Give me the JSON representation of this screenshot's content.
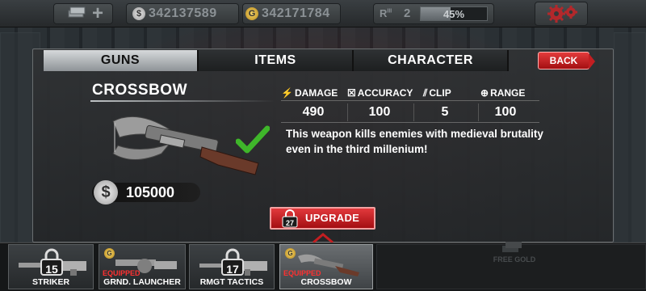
{
  "topbar": {
    "silver_amount": "342137589",
    "gold_amount": "342171784",
    "rank_label": "R",
    "rank_superscript": "III",
    "rank": "2",
    "xp_percent": "45%",
    "xp_fraction": 0.45,
    "silver_symbol": "$",
    "gold_symbol": "G"
  },
  "tabs": [
    {
      "label": "GUNS",
      "active": true
    },
    {
      "label": "ITEMS",
      "active": false
    },
    {
      "label": "CHARACTER",
      "active": false
    }
  ],
  "back_label": "BACK",
  "weapon": {
    "name": "CROSSBOW",
    "price": "105000",
    "price_symbol": "$",
    "description": "This weapon kills enemies with medieval brutality even in the third millenium!",
    "stats": [
      {
        "label": "DAMAGE",
        "value": "490",
        "icon": "lightning-icon"
      },
      {
        "label": "ACCURACY",
        "value": "100",
        "icon": "crosshair-x-icon"
      },
      {
        "label": "CLIP",
        "value": "5",
        "icon": "clip-icon"
      },
      {
        "label": "RANGE",
        "value": "100",
        "icon": "target-icon"
      }
    ]
  },
  "upgrade": {
    "label": "UPGRADE",
    "lock_level": "27"
  },
  "slots": [
    {
      "label": "STRIKER",
      "lock_level": "15",
      "equipped": "",
      "gold": false
    },
    {
      "label": "GRND. LAUNCHER",
      "lock_level": "",
      "equipped": "EQUIPPED",
      "gold": true
    },
    {
      "label": "RMGT TACTICS",
      "lock_level": "17",
      "equipped": "",
      "gold": false
    },
    {
      "label": "CROSSBOW",
      "lock_level": "",
      "equipped": "EQUIPPED",
      "gold": true
    }
  ],
  "free_gold_label": "FREE GOLD",
  "colors": {
    "accent_red": "#c21e21",
    "check_green": "#3fb62a",
    "equipped_red": "#ff3030"
  }
}
